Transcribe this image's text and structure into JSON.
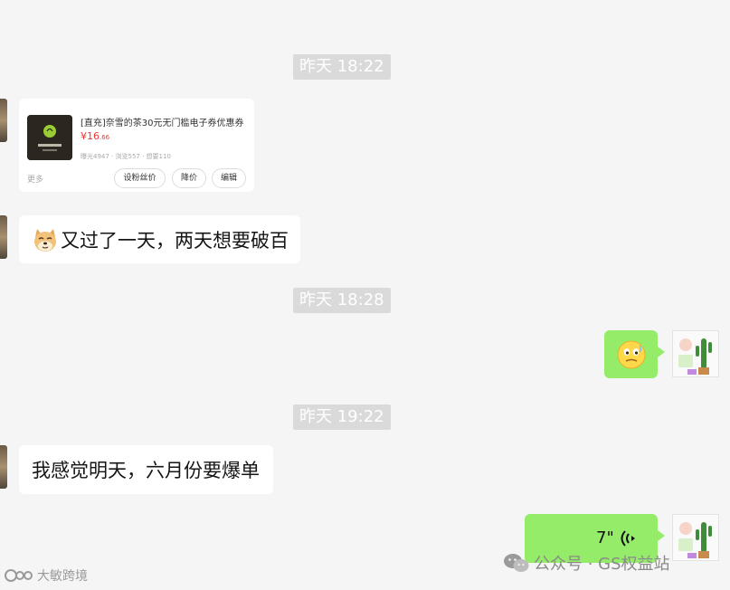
{
  "timestamps": [
    "昨天 18:22",
    "昨天 18:28",
    "昨天 19:22"
  ],
  "product_card": {
    "title": "[直充]奈雪的茶30元无门槛电子券优惠券",
    "price_symbol": "¥",
    "price_main": "16",
    "price_decimal": ".66",
    "stats": "曝光4947 · 浏览557 · 想要110",
    "more_label": "更多",
    "buttons": [
      "设粉丝价",
      "降价",
      "编辑"
    ],
    "thumb_text": "奈雪的茶"
  },
  "messages": {
    "m1_text": "又过了一天，两天想要破百",
    "m2_text": "我感觉明天，六月份要爆单",
    "voice_duration": "7\""
  },
  "watermarks": {
    "right": "公众号 · GS权益站",
    "left": "大敏跨境"
  },
  "colors": {
    "background": "#f5f5f5",
    "bubble_sent": "#95ec69",
    "bubble_received": "#ffffff",
    "timestamp_bg": "#dadada",
    "price": "#e83a3a"
  }
}
